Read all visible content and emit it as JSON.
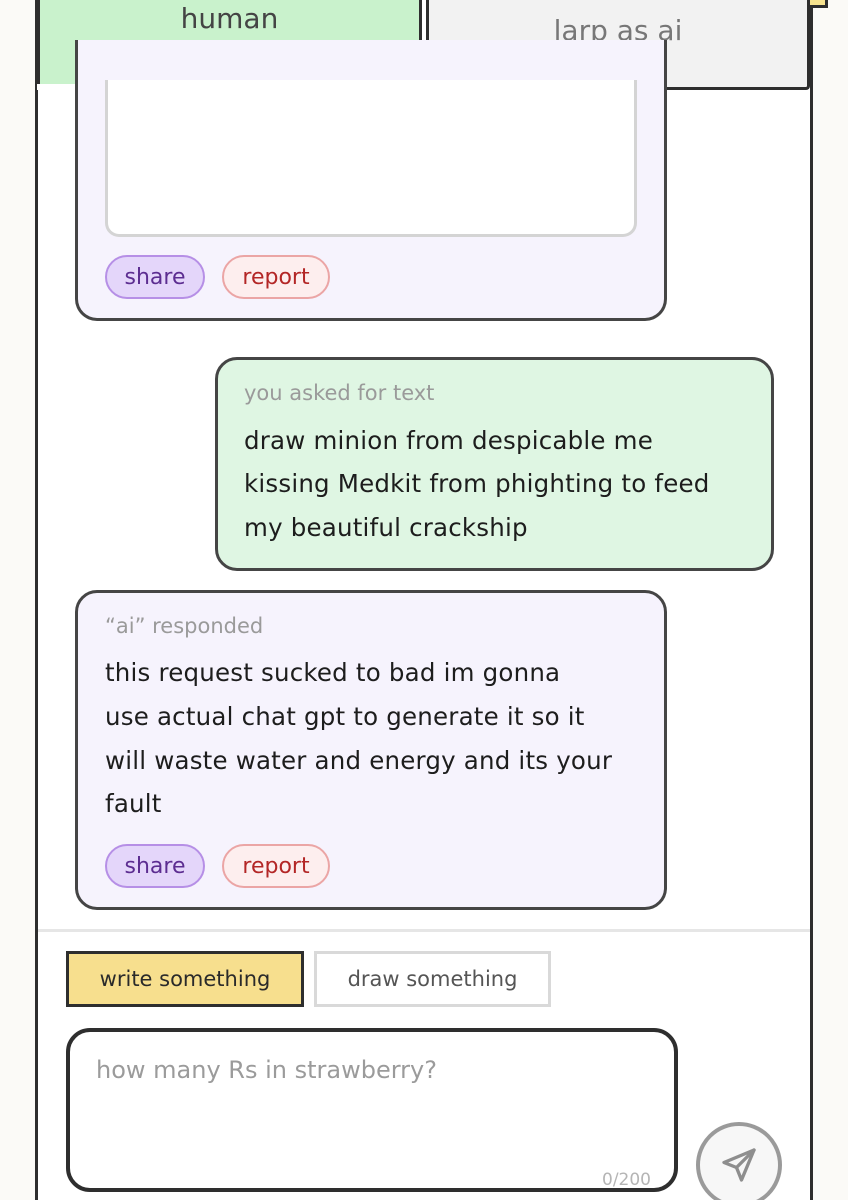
{
  "tabs": {
    "human": "human",
    "larp": "larp as ai"
  },
  "top_card": {
    "share": "share",
    "report": "report"
  },
  "user_message": {
    "meta": "you asked for text",
    "lines": [
      "draw minion from despicable me",
      "kissing Medkit from phighting to feed",
      "my beautiful crackship"
    ]
  },
  "ai_message": {
    "meta": "“ai” responded",
    "lines": [
      "this request sucked to bad im gonna",
      "use actual chat gpt to generate it so it",
      "will waste water and energy and its your",
      "fault"
    ],
    "share": "share",
    "report": "report"
  },
  "composer": {
    "write_label": "write something",
    "draw_label": "draw something",
    "placeholder": "how many Rs in strawberry?",
    "counter": "0/200",
    "send_icon": "send-icon"
  },
  "colors": {
    "human_tab": "#c9f2cc",
    "user_bubble": "#dff6e3",
    "ai_bubble": "#f6f3fd",
    "write_active": "#f7df8e",
    "share_pill": "#e4d6fa",
    "report_pill": "#fdeeee"
  }
}
